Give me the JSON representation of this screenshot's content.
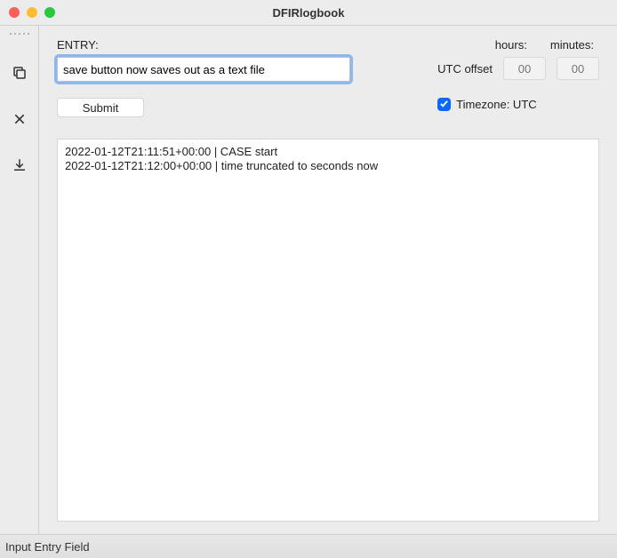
{
  "window": {
    "title": "DFIRlogbook"
  },
  "sidebar": {
    "copy_tooltip": "Copy",
    "close_tooltip": "Close",
    "export_tooltip": "Export"
  },
  "entry": {
    "label": "ENTRY:",
    "value": "save button now saves out as a text file"
  },
  "submit": {
    "label": "Submit"
  },
  "offset": {
    "hours_label": "hours:",
    "minutes_label": "minutes:",
    "utc_label": "UTC offset",
    "hours_placeholder": "00",
    "minutes_placeholder": "00"
  },
  "timezone": {
    "checked": true,
    "label": "Timezone: UTC"
  },
  "log": {
    "entries": [
      "2022-01-12T21:11:51+00:00 | CASE start",
      "2022-01-12T21:12:00+00:00 | time truncated to seconds now"
    ]
  },
  "statusbar": {
    "text": "Input Entry Field"
  }
}
